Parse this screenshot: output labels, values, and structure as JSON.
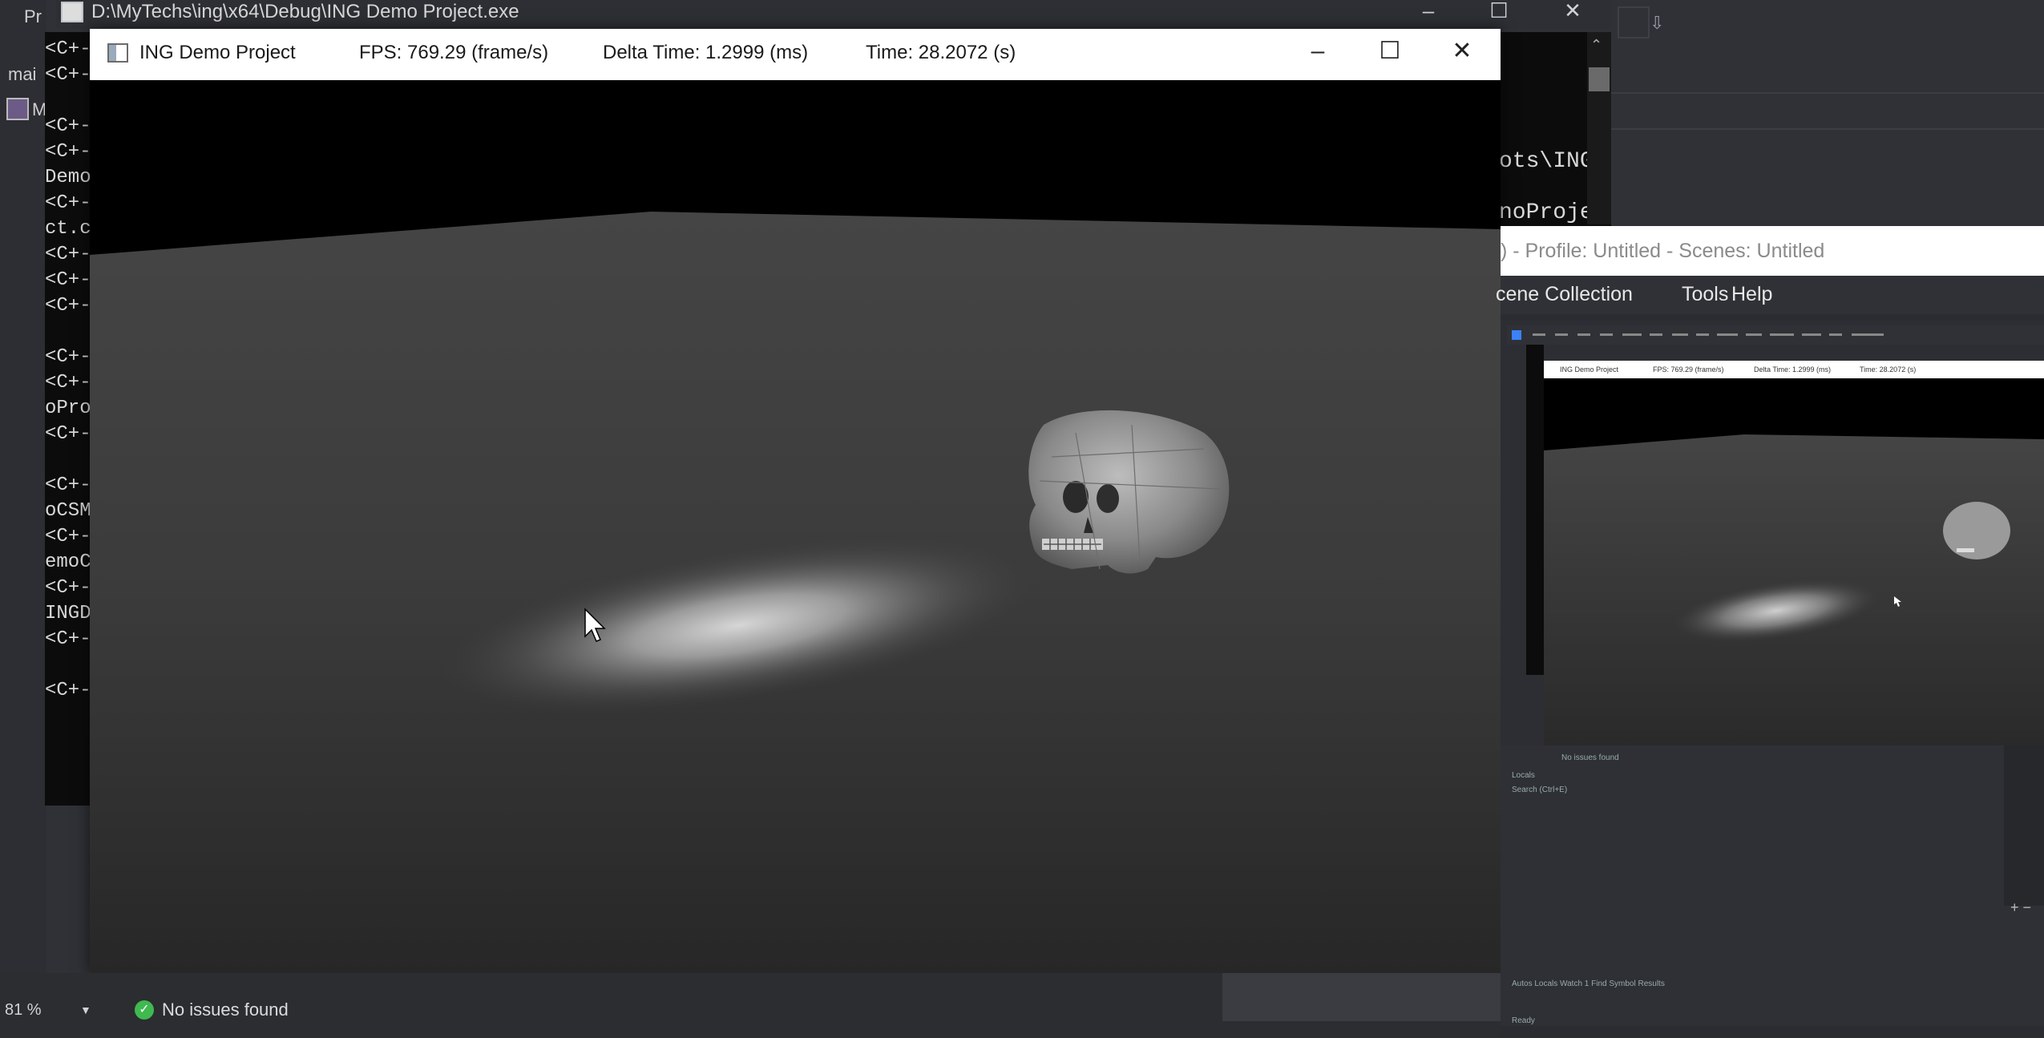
{
  "ide": {
    "tab_partial": "Pr",
    "main_partial": "mai",
    "icon_label": "M",
    "zoom": "81 %",
    "issues": "No issues found"
  },
  "console": {
    "title": "D:\\MyTechs\\ing\\x64\\Debug\\ING Demo Project.exe",
    "lines": [
      "<C+-",
      "<C+-",
      "",
      "<C+-",
      "<C+-",
      "Demo",
      "<C+-",
      "ct.c",
      "<C+-",
      "<C+-",
      "<C+-",
      "",
      "<C+-",
      "<C+-",
      "oPro",
      "<C+-",
      "",
      "<C+-",
      "oCSM",
      "<C+-",
      "emoC",
      "<C+-",
      "INGD",
      "<C+-",
      "",
      "<C+-"
    ],
    "right_fragments": [
      "ots\\ING",
      "noProje"
    ]
  },
  "demo": {
    "title": "ING Demo Project",
    "fps": "FPS: 769.29 (frame/s)",
    "delta": "Delta Time: 1.2999 (ms)",
    "time": "Time: 28.2072 (s)"
  },
  "obs": {
    "title": ") - Profile: Untitled - Scenes: Untitled",
    "menu": [
      "cene Collection",
      "Tools",
      "Help"
    ],
    "mini": {
      "title": "ING Demo Project",
      "fps": "FPS: 769.29 (frame/s)",
      "delta": "Delta Time: 1.2999 (ms)",
      "time": "Time: 28.2072 (s)",
      "issues": "No issues found",
      "locals": "Locals",
      "search": "Search (Ctrl+E)",
      "tabs": "Autos   Locals   Watch 1   Find Symbol Results",
      "ready": "Ready"
    }
  },
  "colors": {
    "success": "#3fb950",
    "titlebar": "#ffffff",
    "console_bg": "#0c0c0c"
  },
  "icons": [
    "app-window-icon",
    "minimize-icon",
    "maximize-icon",
    "close-icon",
    "check-circle-icon",
    "chevron-down-icon",
    "mouse-cursor-icon",
    "skull-model"
  ]
}
